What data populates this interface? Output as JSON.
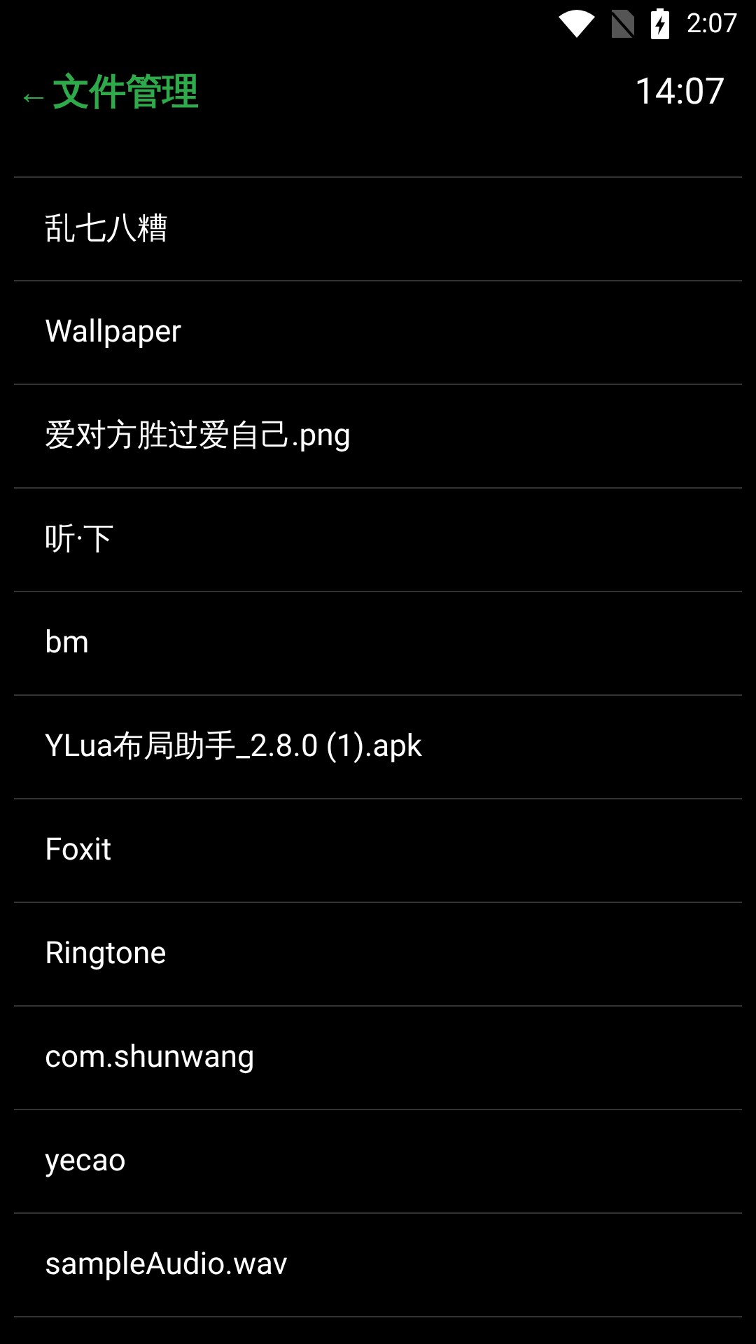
{
  "status_bar": {
    "time": "2:07"
  },
  "header": {
    "back": "←",
    "title": "文件管理",
    "clock": "14:07"
  },
  "files": [
    {
      "name": "乱七八糟"
    },
    {
      "name": "Wallpaper"
    },
    {
      "name": "爱对方胜过爱自己.png"
    },
    {
      "name": "听·下"
    },
    {
      "name": "bm"
    },
    {
      "name": "YLua布局助手_2.8.0 (1).apk"
    },
    {
      "name": "Foxit"
    },
    {
      "name": "Ringtone"
    },
    {
      "name": "com.shunwang"
    },
    {
      "name": "yecao"
    },
    {
      "name": "sampleAudio.wav"
    }
  ]
}
